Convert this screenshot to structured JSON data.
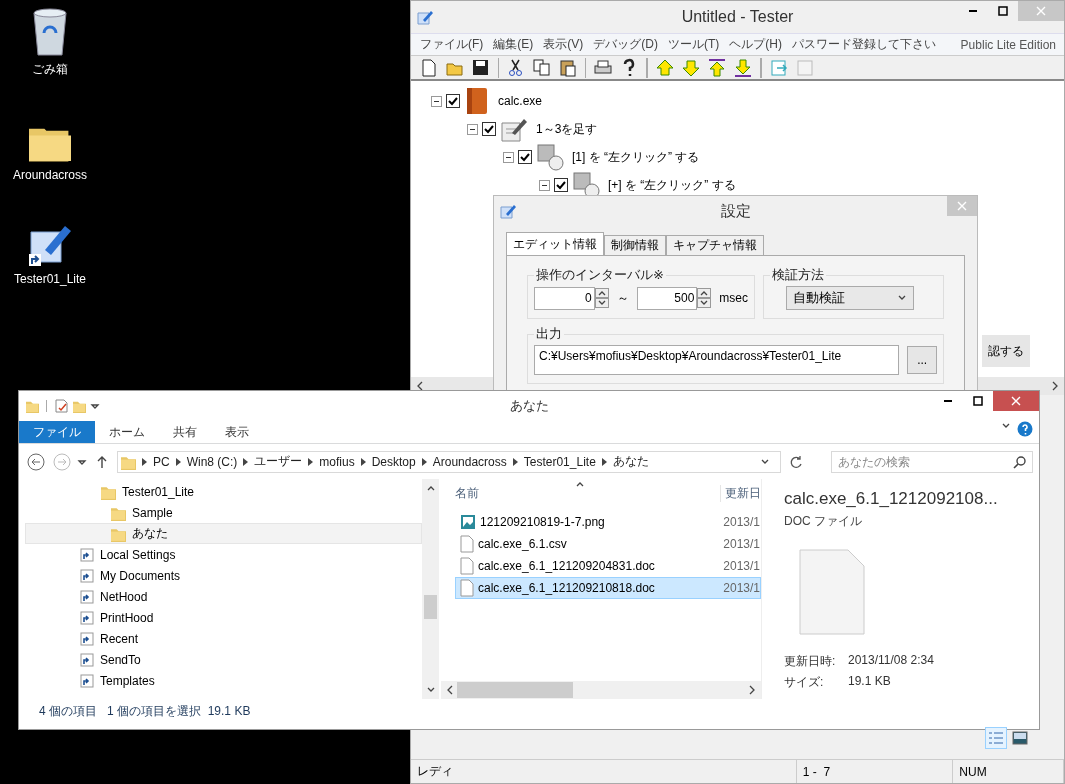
{
  "desktop_icons": [
    {
      "label": "ごみ箱",
      "kind": "recycle"
    },
    {
      "label": "Aroundacross",
      "kind": "folder"
    },
    {
      "label": "Tester01_Lite",
      "kind": "shortcut"
    }
  ],
  "tester": {
    "title": "Untitled - Tester",
    "menu": [
      "ファイル(F)",
      "編集(E)",
      "表示(V)",
      "デバッグ(D)",
      "ツール(T)",
      "ヘルプ(H)",
      "パスワード登録して下さい"
    ],
    "edition": "Public Lite Edition",
    "tree": [
      {
        "label": "calc.exe",
        "kind": "app",
        "checked": true,
        "expanded": true,
        "children": [
          {
            "label": "1～3を足す",
            "kind": "note",
            "checked": true,
            "expanded": true,
            "children": [
              {
                "label": "[1] を “左クリック” する",
                "kind": "mouse",
                "checked": true,
                "expanded": true,
                "children": [
                  {
                    "label": "[+] を “左クリック” する",
                    "kind": "mouse",
                    "checked": true,
                    "expanded": true
                  }
                ]
              }
            ]
          }
        ]
      }
    ],
    "partial_button": "認する",
    "status": [
      "レディ",
      "1 -  7",
      "NUM"
    ]
  },
  "dialog": {
    "title": "設定",
    "tabs": [
      {
        "label": "エディット情報",
        "selected": true
      },
      {
        "label": "制御情報",
        "selected": false
      },
      {
        "label": "キャプチャ情報",
        "selected": false
      }
    ],
    "interval": {
      "label": "操作のインターバル※",
      "from": "0",
      "separator": "～",
      "to": "500",
      "unit": "msec"
    },
    "verify": {
      "label": "検証方法",
      "value": "自動検証"
    },
    "output": {
      "label": "出力",
      "value": "C:¥Users¥mofius¥Desktop¥Aroundacross¥Tester01_Lite",
      "browse": "..."
    }
  },
  "explorer": {
    "title": "あなた",
    "ribbon_tabs": [
      {
        "label": "ファイル",
        "selected": true
      },
      {
        "label": "ホーム",
        "selected": false
      },
      {
        "label": "共有",
        "selected": false
      },
      {
        "label": "表示",
        "selected": false
      }
    ],
    "breadcrumb": [
      "PC",
      "Win8 (C:)",
      "ユーザー",
      "mofius",
      "Desktop",
      "Aroundacross",
      "Tester01_Lite",
      "あなた"
    ],
    "search": {
      "placeholder": "あなたの検索"
    },
    "nav": [
      {
        "label": "Tester01_Lite",
        "kind": "folder",
        "selected": false,
        "children": [
          {
            "label": "Sample",
            "kind": "folder",
            "selected": false
          },
          {
            "label": "あなた",
            "kind": "folder",
            "selected": true
          }
        ]
      },
      {
        "label": "Local Settings",
        "kind": "shortcut",
        "selected": false
      },
      {
        "label": "My Documents",
        "kind": "shortcut",
        "selected": false
      },
      {
        "label": "NetHood",
        "kind": "shortcut",
        "selected": false
      },
      {
        "label": "PrintHood",
        "kind": "shortcut",
        "selected": false
      },
      {
        "label": "Recent",
        "kind": "shortcut",
        "selected": false
      },
      {
        "label": "SendTo",
        "kind": "shortcut",
        "selected": false
      },
      {
        "label": "Templates",
        "kind": "shortcut",
        "selected": false
      }
    ],
    "columns": [
      "名前",
      "更新日"
    ],
    "files": [
      {
        "name": "121209210819-1-7.png",
        "date": "2013/1",
        "kind": "image",
        "selected": false
      },
      {
        "name": "calc.exe_6.1.csv",
        "date": "2013/1",
        "kind": "file",
        "selected": false
      },
      {
        "name": "calc.exe_6.1_121209204831.doc",
        "date": "2013/1",
        "kind": "file",
        "selected": false
      },
      {
        "name": "calc.exe_6.1_121209210818.doc",
        "date": "2013/1",
        "kind": "file",
        "selected": true
      }
    ],
    "preview": {
      "title": "calc.exe_6.1_1212092108...",
      "type": "DOC ファイル",
      "properties": [
        {
          "label": "更新日時:",
          "value": "2013/11/08 2:34"
        },
        {
          "label": "サイズ:",
          "value": "19.1 KB"
        }
      ]
    },
    "views": [
      {
        "kind": "details",
        "selected": true
      },
      {
        "kind": "preview",
        "selected": false
      }
    ],
    "status": [
      "4 個の項目",
      "1 個の項目を選択  19.1 KB"
    ]
  }
}
